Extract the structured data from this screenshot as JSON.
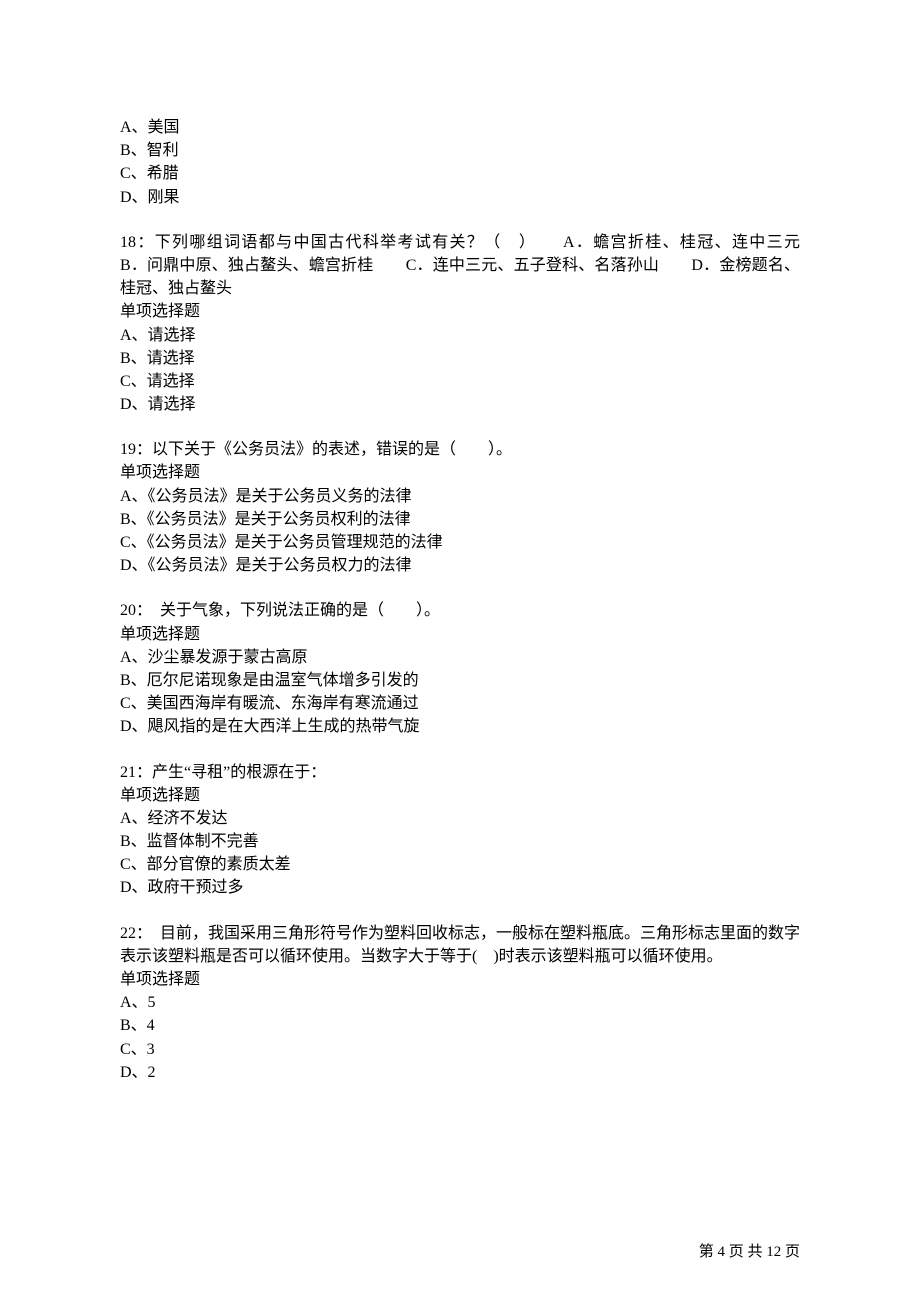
{
  "q17_opts": {
    "a": "A、美国",
    "b": "B、智利",
    "c": "C、希腊",
    "d": "D、刚果"
  },
  "q18": {
    "text": "18：下列哪组词语都与中国古代科举考试有关？（　）　　A．蟾宫折桂、桂冠、连中三元　　B．问鼎中原、独占鳌头、蟾宫折桂　　C．连中三元、五子登科、名落孙山　　D．金榜题名、桂冠、独占鳌头",
    "type": "单项选择题",
    "a": "A、请选择",
    "b": "B、请选择",
    "c": "C、请选择",
    "d": "D、请选择"
  },
  "q19": {
    "text": "19：以下关于《公务员法》的表述，错误的是（　　）。",
    "type": "单项选择题",
    "a": "A、《公务员法》是关于公务员义务的法律",
    "b": "B、《公务员法》是关于公务员权利的法律",
    "c": "C、《公务员法》是关于公务员管理规范的法律",
    "d": "D、《公务员法》是关于公务员权力的法律"
  },
  "q20": {
    "text": "20：　关于气象，下列说法正确的是（　　）。",
    "type": "单项选择题",
    "a": "A、沙尘暴发源于蒙古高原",
    "b": "B、厄尔尼诺现象是由温室气体增多引发的",
    "c": "C、美国西海岸有暖流、东海岸有寒流通过",
    "d": "D、飓风指的是在大西洋上生成的热带气旋"
  },
  "q21": {
    "text": "21：产生“寻租”的根源在于：",
    "type": "单项选择题",
    "a": "A、经济不发达",
    "b": "B、监督体制不完善",
    "c": "C、部分官僚的素质太差",
    "d": "D、政府干预过多"
  },
  "q22": {
    "text": "22：　目前，我国采用三角形符号作为塑料回收标志，一般标在塑料瓶底。三角形标志里面的数字表示该塑料瓶是否可以循环使用。当数字大于等于(　)时表示该塑料瓶可以循环使用。",
    "type": "单项选择题",
    "a": "A、5",
    "b": "B、4",
    "c": "C、3",
    "d": "D、2"
  },
  "footer": "第 4 页 共 12 页"
}
